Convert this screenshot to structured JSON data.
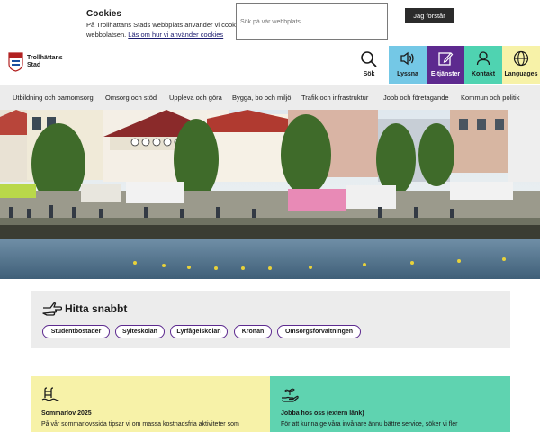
{
  "cookie": {
    "title": "Cookies",
    "text": "På Trollhättans Stads webbplats använder vi cookies för att förbättra webbplatsen.",
    "link": "Läs om hur vi använder cookies",
    "button": "Jag förstår"
  },
  "header": {
    "logo_text": "Trollhättans Stad",
    "search_placeholder": "Sök på vår webbplats",
    "search_button": "Sök",
    "quick_buttons": [
      {
        "label": "Lyssna",
        "icon": "speaker-icon",
        "color": "#74c8e6"
      },
      {
        "label": "E-tjänster",
        "icon": "edit-icon",
        "color": "#5d2a8f"
      },
      {
        "label": "Kontakt",
        "icon": "person-icon",
        "color": "#4fd3b1"
      },
      {
        "label": "Languages",
        "icon": "globe-icon",
        "color": "#f7f2a8"
      }
    ]
  },
  "nav": {
    "items": [
      "Utbildning och barnomsorg",
      "Omsorg och stöd",
      "Uppleva och göra",
      "Bygga, bo och miljö",
      "Trafik och infrastruktur",
      "Jobb och företagande",
      "Kommun och politik"
    ]
  },
  "quick": {
    "title": "Hitta snabbt",
    "chips": [
      "Studentbostäder",
      "Sylteskolan",
      "Lyrfågelskolan",
      "Kronan",
      "Omsorgsförvaltningen"
    ]
  },
  "cards": [
    {
      "title": "Sommarlov 2025",
      "text": "På vår sommarlovssida tipsar vi om massa kostnadsfria aktiviteter som",
      "color": "#f7f2a8",
      "icon": "swimming-icon"
    },
    {
      "title": "Jobba hos oss (extern länk)",
      "text": "För att kunna ge våra invånare ännu bättre service, söker vi fler",
      "color": "#5fd3b0",
      "icon": "hand-plant-icon"
    }
  ],
  "colors": {
    "brand_purple": "#5d2a8f",
    "nav_bg": "#ececec"
  }
}
